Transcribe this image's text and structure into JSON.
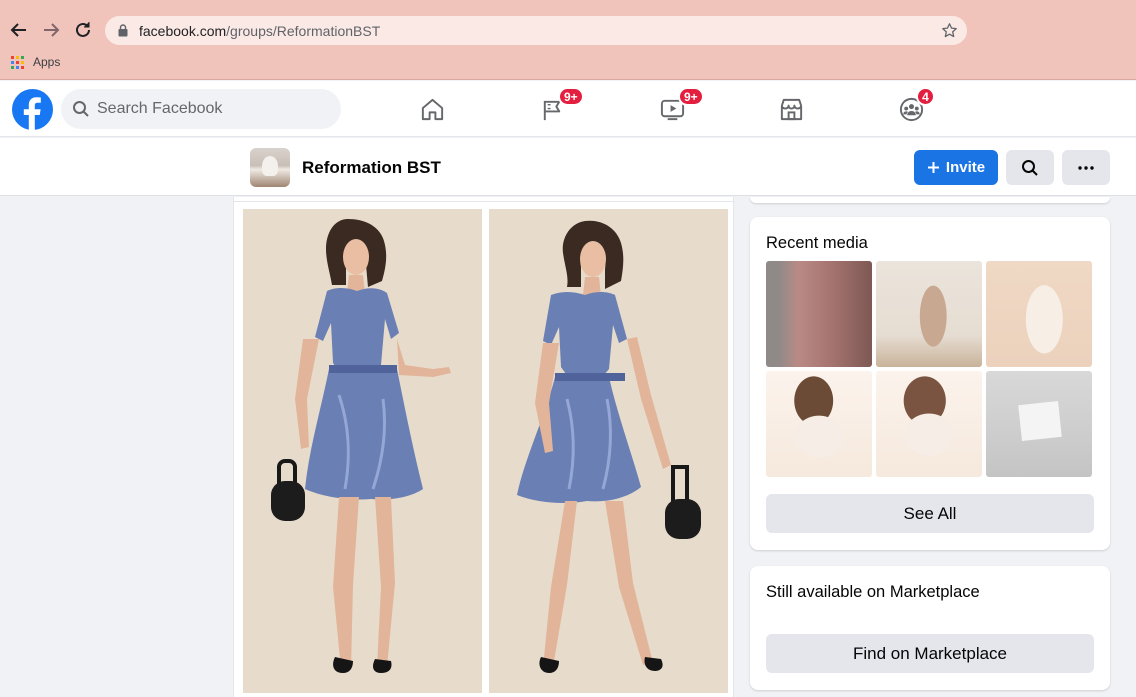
{
  "browser": {
    "url_host": "facebook.com",
    "url_path": "/groups/ReformationBST",
    "bookmarks": [
      {
        "label": "Apps"
      }
    ]
  },
  "topbar": {
    "search_placeholder": "Search Facebook",
    "tabs": [
      {
        "name": "home",
        "icon": "home-icon",
        "badge": ""
      },
      {
        "name": "pages",
        "icon": "flag-icon",
        "badge": "9+"
      },
      {
        "name": "watch",
        "icon": "video-icon",
        "badge": "9+"
      },
      {
        "name": "marketplace",
        "icon": "marketplace-icon",
        "badge": ""
      },
      {
        "name": "groups",
        "icon": "groups-icon",
        "badge": "4"
      }
    ]
  },
  "group": {
    "name": "Reformation BST",
    "invite_label": "Invite"
  },
  "sidebar": {
    "recent_media_title": "Recent media",
    "see_all_label": "See All",
    "marketplace_title": "Still available on Marketplace",
    "find_marketplace_label": "Find on Marketplace"
  },
  "colors": {
    "brand": "#1877f2",
    "badge": "#e41e3f",
    "chrome": "#f1c4bb"
  }
}
